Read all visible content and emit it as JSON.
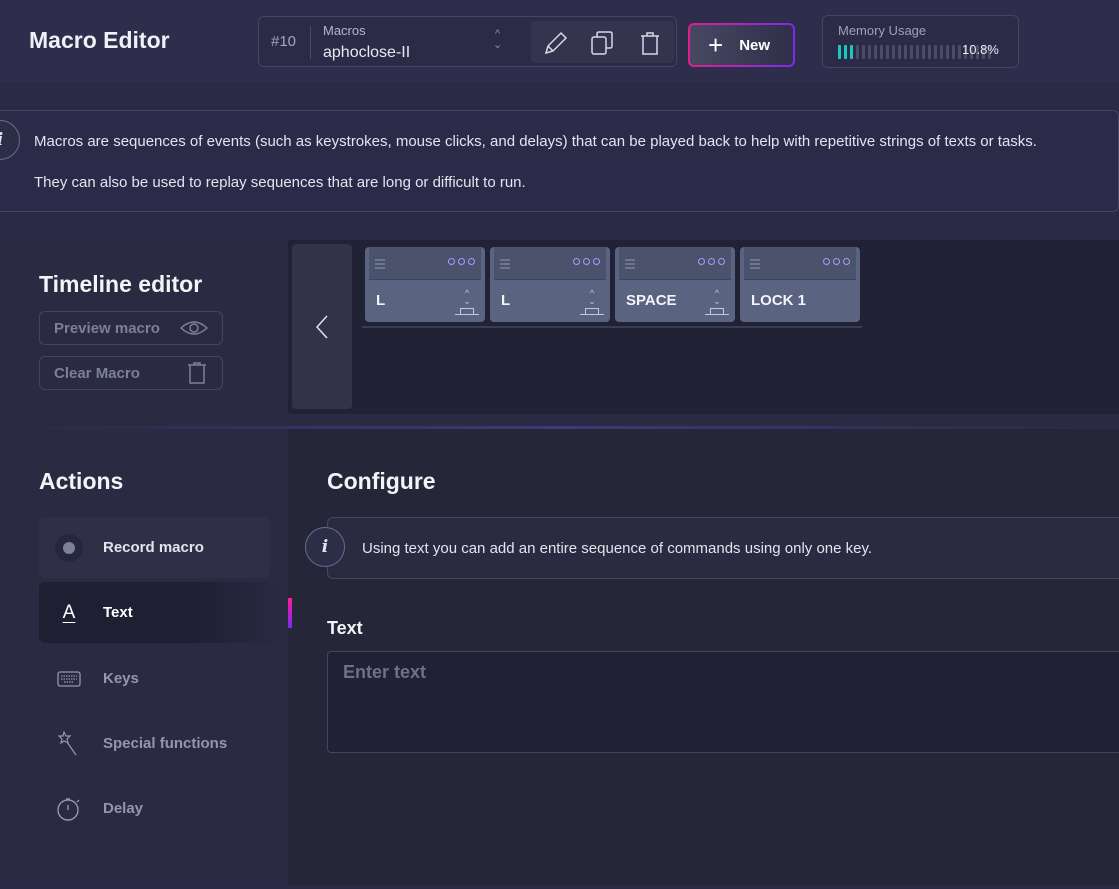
{
  "header": {
    "title": "Macro Editor",
    "macro_number": "#10",
    "macro_label": "Macros",
    "macro_name": "aphoclose-II",
    "new_label": "New",
    "memory": {
      "label": "Memory Usage",
      "value_text": "10.8%",
      "value": 10.8
    }
  },
  "banner": {
    "line1": "Macros are sequences of events (such as keystrokes, mouse clicks, and delays) that can be played back to help with repetitive strings of texts or tasks.",
    "line2": "They can also be used to replay sequences that are long or difficult to run."
  },
  "timeline": {
    "title": "Timeline editor",
    "preview_label": "Preview macro",
    "clear_label": "Clear Macro",
    "items": [
      {
        "key": "L"
      },
      {
        "key": "L"
      },
      {
        "key": "SPACE"
      },
      {
        "key": "LOCK 1"
      }
    ]
  },
  "actions": {
    "title": "Actions",
    "items": [
      {
        "label": "Record macro"
      },
      {
        "label": "Text",
        "active": true
      },
      {
        "label": "Keys"
      },
      {
        "label": "Special functions"
      },
      {
        "label": "Delay"
      }
    ]
  },
  "configure": {
    "title": "Configure",
    "info": "Using text you can add an entire sequence of commands using only one key.",
    "text_label": "Text",
    "text_placeholder": "Enter text",
    "text_value": ""
  },
  "colors": {
    "accent_pink": "#e0208a",
    "accent_purple": "#7a2cf0",
    "memory_fill": "#19c9c0"
  }
}
